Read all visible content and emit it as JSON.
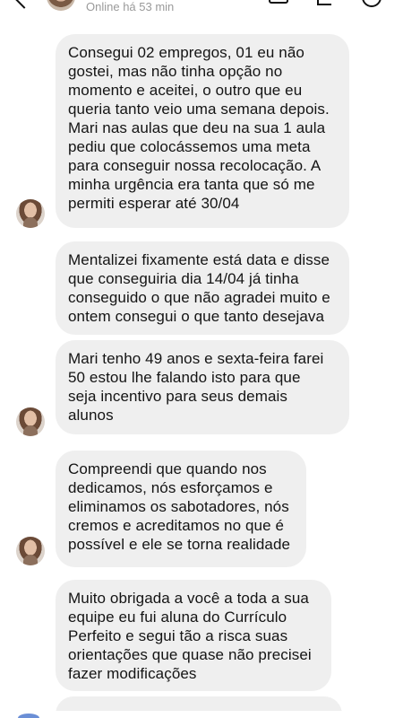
{
  "header": {
    "status": "Online há 53 min"
  },
  "messages": [
    {
      "text": "Consegui 02 empregos, 01 eu não\ngostei, mas não tinha opção no\nmomento e aceitei, o outro que eu\nqueria tanto veio uma semana depois.\nMari nas aulas que deu na sua 1 aula\npediu que colocássemos uma meta\npara conseguir nossa recolocação. A\nminha urgência era tanta que só me\npermiti esperar até 30/04"
    },
    {
      "text": "Mentalizei fixamente está data e disse\nque conseguiria dia 14/04 já tinha\nconseguido o que não agradei muito e\nontem consegui o que tanto desejava"
    },
    {
      "text": "Mari tenho 49 anos e sexta-feira farei\n50 estou lhe falando isto para que\nseja incentivo para seus demais\nalunos"
    },
    {
      "text": "Compreendi que quando nos\ndedicamos, nós esforçamos e\neliminamos os sabotadores, nós\ncremos e acreditamos no que é\npossível e ele se torna realidade"
    },
    {
      "text": "Muito obrigada a você a toda a sua\nequipe eu fui aluna do Currículo\nPerfeito e segui tão a risca suas\norientações que quase não precisei\nfazer modificações"
    }
  ],
  "colors": {
    "bubble": "#efefef",
    "status_text": "#9a9a9a"
  },
  "icons": [
    "back-chevron-icon",
    "video-call-icon",
    "flag-icon",
    "info-icon"
  ]
}
